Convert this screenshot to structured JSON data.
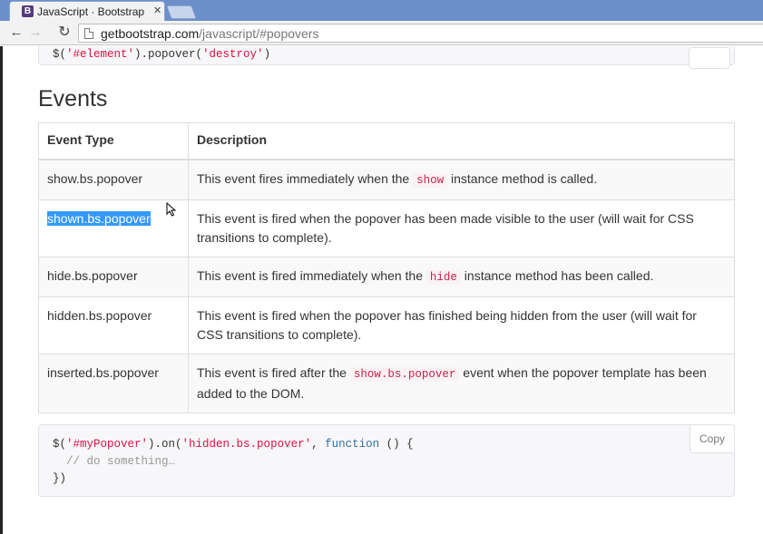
{
  "browser": {
    "tab_title": "JavaScript · Bootstrap",
    "tab_favicon": "B",
    "url_host": "getbootstrap.com",
    "url_path": "/javascript/#popovers"
  },
  "previous_code": {
    "prefix": "$(",
    "selector": "'#element'",
    "middle": ").popover(",
    "method": "'destroy'",
    "suffix": ")"
  },
  "events": {
    "heading": "Events",
    "columns": [
      "Event Type",
      "Description"
    ],
    "rows": [
      {
        "type": "show.bs.popover",
        "desc_before": "This event fires immediately when the ",
        "code": "show",
        "desc_after": " instance method is called."
      },
      {
        "type": "shown.bs.popover",
        "desc_before": "This event is fired when the popover has been made visible to the user (will wait for CSS transitions to complete).",
        "code": "",
        "desc_after": ""
      },
      {
        "type": "hide.bs.popover",
        "desc_before": "This event is fired immediately when the ",
        "code": "hide",
        "desc_after": " instance method has been called."
      },
      {
        "type": "hidden.bs.popover",
        "desc_before": "This event is fired when the popover has finished being hidden from the user (will wait for CSS transitions to complete).",
        "code": "",
        "desc_after": ""
      },
      {
        "type": "inserted.bs.popover",
        "desc_before": "This event is fired after the ",
        "code": "show.bs.popover",
        "desc_after": " event when the popover template has been added to the DOM."
      }
    ]
  },
  "example_code": {
    "copy_label": "Copy",
    "line1_prefix": "$(",
    "line1_selector": "'#myPopover'",
    "line1_mid": ").on(",
    "line1_event": "'hidden.bs.popover'",
    "line1_comma": ", ",
    "line1_keyword": "function",
    "line1_suffix": " () {",
    "line2": "  // do something…",
    "line3": "})"
  }
}
